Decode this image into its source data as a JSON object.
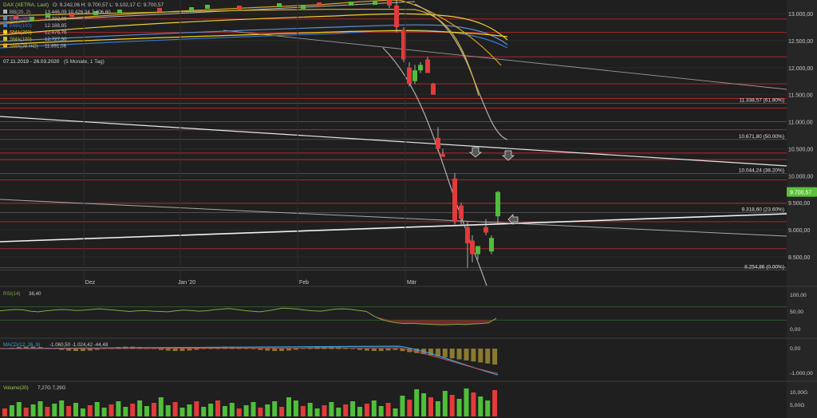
{
  "chart_data": [
    {
      "type": "candlestick",
      "header": {
        "symbol": "DAX (XETRA, Last)",
        "ohlc_text": "O: 9.242,06  H: 9.700,57  L: 9.102,17  C: 9.700,57",
        "period": "07.11.2019 - 26.03.2020",
        "period_note": "(5 Monate, 1 Tag)"
      },
      "indicator_legend": [
        {
          "label": "BB(20, 2)",
          "value": "13.446,09 10.426,34 7.406,60",
          "color": "#b0b0b0"
        },
        {
          "label": "EMA(200)",
          "value": "12.332,65",
          "color": "#5b8fd6"
        },
        {
          "label": "EMA(100)",
          "value": "12.188,85",
          "color": "#3a7ad0"
        },
        {
          "label": "SMA(200)",
          "value": "12.476,76",
          "color": "#f0d030"
        },
        {
          "label": "SMA(100)",
          "value": "12.727,30",
          "color": "#d8c020"
        },
        {
          "label": "SMA(38 Hi2)",
          "value": "11.891,06",
          "color": "#e8b020"
        }
      ],
      "x_labels": [
        "Dez",
        "Jan '20",
        "Feb",
        "Mär"
      ],
      "y_ticks": [
        8500,
        9000,
        9500,
        10000,
        10500,
        11000,
        11500,
        12000,
        12500,
        13000
      ],
      "y_tick_labels": [
        "8.500,00",
        "9.000,00",
        "9.500,00",
        "10.000,00",
        "10.500,00",
        "11.000,00",
        "11.500,00",
        "12.000,00",
        "12.500,00",
        "13.000,00"
      ],
      "ylim": [
        8000,
        13350
      ],
      "last_price": {
        "value": 9700.57,
        "label": "9.700,57"
      },
      "fib_levels": [
        {
          "value": 11338.57,
          "label": "11.338,57 (61.80%)"
        },
        {
          "value": 10671.8,
          "label": "10.671,80 (50.00%)"
        },
        {
          "value": 10044.24,
          "label": "10.044,24 (38.20%)"
        },
        {
          "value": 9318.6,
          "label": "9.318,60 (23.60%)"
        },
        {
          "value": 8254.86,
          "label": "8.254,86 (0.00%)"
        }
      ],
      "horizontal_levels": [
        12900,
        12650,
        12200,
        11700,
        11430,
        11250,
        11000,
        10850,
        10420,
        10300,
        9925,
        9490,
        9150,
        8650,
        8300
      ],
      "candles_visible": [
        {
          "o": 13500,
          "h": 13540,
          "l": 13100,
          "c": 13150
        },
        {
          "o": 13150,
          "h": 13250,
          "l": 12650,
          "c": 12750
        },
        {
          "o": 12700,
          "h": 12750,
          "l": 12100,
          "c": 12150
        },
        {
          "o": 12000,
          "h": 12100,
          "l": 11650,
          "c": 11700
        },
        {
          "o": 11750,
          "h": 12050,
          "l": 11700,
          "c": 11950
        },
        {
          "o": 11950,
          "h": 12100,
          "l": 11900,
          "c": 12050
        },
        {
          "o": 12150,
          "h": 12200,
          "l": 11900,
          "c": 11900
        },
        {
          "o": 11700,
          "h": 11720,
          "l": 11500,
          "c": 11500
        },
        {
          "o": 10700,
          "h": 10900,
          "l": 10450,
          "c": 10500
        },
        {
          "o": 10400,
          "h": 10500,
          "l": 10350,
          "c": 10350
        },
        {
          "o": 9950,
          "h": 10050,
          "l": 9100,
          "c": 9150
        },
        {
          "o": 9450,
          "h": 9500,
          "l": 9100,
          "c": 9200
        },
        {
          "o": 9050,
          "h": 9150,
          "l": 8300,
          "c": 8750
        },
        {
          "o": 8800,
          "h": 8900,
          "l": 8400,
          "c": 8550
        },
        {
          "o": 8550,
          "h": 8700,
          "l": 8450,
          "c": 8700
        },
        {
          "o": 9050,
          "h": 9200,
          "l": 8900,
          "c": 8950
        },
        {
          "o": 8600,
          "h": 8900,
          "l": 8550,
          "c": 8850
        },
        {
          "o": 9250,
          "h": 9720,
          "l": 9100,
          "c": 9700
        }
      ]
    },
    {
      "type": "line",
      "name": "RSI",
      "legend": "RSI(14)",
      "legend_value": "36,40",
      "y_tick_labels": [
        "100,00",
        "50,00",
        "0,00"
      ],
      "ylim": [
        0,
        100
      ],
      "values": [
        58,
        60,
        62,
        61,
        57,
        55,
        58,
        60,
        62,
        61,
        59,
        60,
        62,
        64,
        62,
        60,
        58,
        56,
        58,
        59,
        57,
        56,
        55,
        58,
        60,
        59,
        57,
        58,
        61,
        63,
        65,
        62,
        59,
        57,
        55,
        58,
        62,
        66,
        65,
        63,
        60,
        58,
        57,
        60,
        63,
        64,
        62,
        59,
        56,
        42,
        32,
        26,
        22,
        20,
        21,
        19,
        18,
        17,
        16,
        17,
        18,
        17,
        19,
        20,
        22,
        36
      ]
    },
    {
      "type": "line",
      "name": "MACD",
      "legend": "MACD(12, 26, 9)",
      "legend_value": "-1.060,50 -1.024,42 -44,48",
      "y_tick_labels": [
        "0,00",
        "-1.000,00"
      ]
    },
    {
      "type": "bar",
      "name": "Volume",
      "legend": "Volume(20)",
      "legend_value": "7,27G  7,29G",
      "y_tick_labels": [
        "10,00G",
        "5,00G"
      ]
    }
  ]
}
